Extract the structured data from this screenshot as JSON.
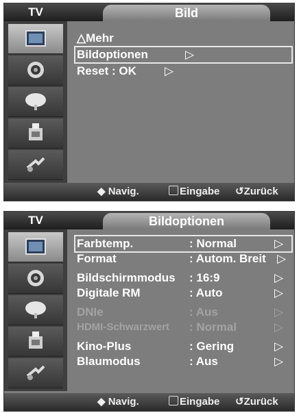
{
  "screen1": {
    "tv_label": "TV",
    "title": "Bild",
    "menu": [
      {
        "label": "△Mehr",
        "arrow": ""
      },
      {
        "label": "Bildoptionen",
        "arrow": "▷"
      },
      {
        "label": "Reset  : OK",
        "arrow": "▷"
      }
    ],
    "hints": {
      "navig": "Navig.",
      "eingabe": "Eingabe",
      "zurueck": "Zurück"
    }
  },
  "screen2": {
    "tv_label": "TV",
    "title": "Bildoptionen",
    "menu": [
      {
        "label": "Farbtemp.",
        "value": ": Normal",
        "arrow": "▷"
      },
      {
        "label": "Format",
        "value": ": Autom. Breit",
        "arrow": "▷"
      },
      {
        "label": "Bildschirmmodus",
        "value": ": 16:9",
        "arrow": "▷"
      },
      {
        "label": "Digitale RM",
        "value": ": Auto",
        "arrow": "▷"
      },
      {
        "label": "DNIe",
        "value": ": Aus",
        "arrow": "▷"
      },
      {
        "label": "HDMI-Schwarzwert",
        "value": ": Normal",
        "arrow": "▷"
      },
      {
        "label": "Kino-Plus",
        "value": ": Gering",
        "arrow": "▷"
      },
      {
        "label": "Blaumodus",
        "value": ": Aus",
        "arrow": "▷"
      }
    ],
    "hints": {
      "navig": "Navig.",
      "eingabe": "Eingabe",
      "zurueck": "Zurück"
    }
  },
  "sidebar_icons": [
    "picture-icon",
    "sound-icon",
    "channel-icon",
    "setup-icon",
    "input-icon"
  ]
}
